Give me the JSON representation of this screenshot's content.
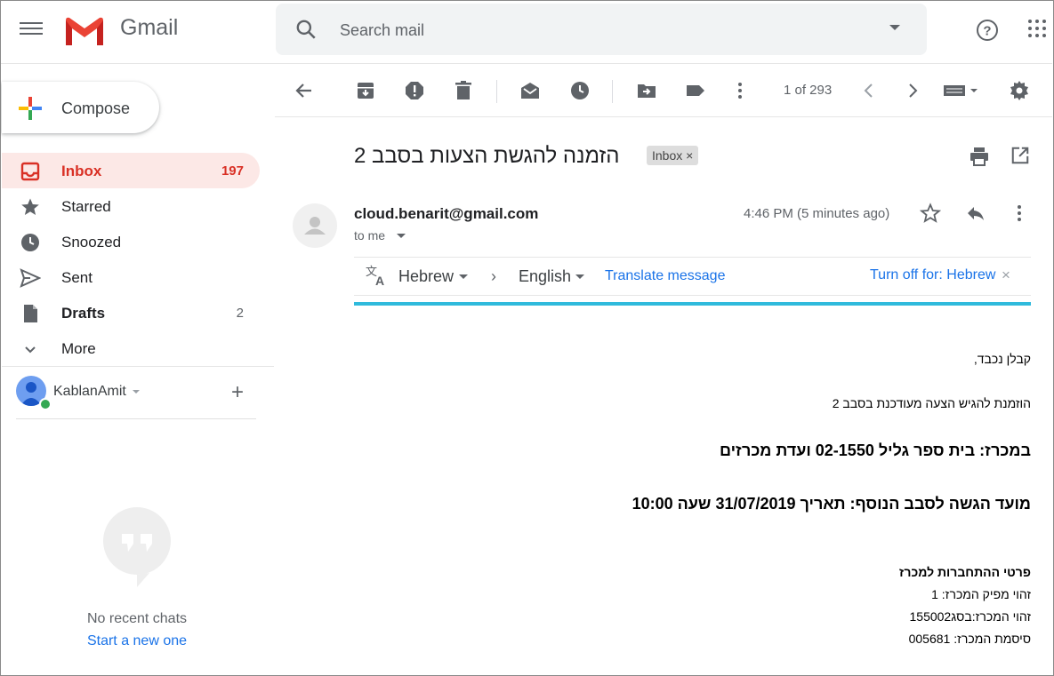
{
  "app": {
    "logo_text": "Gmail"
  },
  "search": {
    "placeholder": "Search mail"
  },
  "compose": {
    "label": "Compose"
  },
  "nav": [
    {
      "label": "Inbox",
      "count": "197",
      "icon": "inbox-icon",
      "active": true
    },
    {
      "label": "Starred",
      "count": "",
      "icon": "star-icon"
    },
    {
      "label": "Snoozed",
      "count": "",
      "icon": "clock-icon"
    },
    {
      "label": "Sent",
      "count": "",
      "icon": "send-icon"
    },
    {
      "label": "Drafts",
      "count": "2",
      "icon": "draft-icon"
    },
    {
      "label": "More",
      "count": "",
      "icon": "chevron-down-icon"
    }
  ],
  "hangouts": {
    "user": "KablanAmit",
    "no_chats": "No recent chats",
    "start_link": "Start a new one"
  },
  "toolbar": {
    "pager": "1 of 293"
  },
  "message": {
    "subject": "הזמנה להגשת הצעות בסבב 2",
    "label_chip": "Inbox",
    "sender": "cloud.benarit@gmail.com",
    "recipient": "to me",
    "time": "4:46 PM (5 minutes ago)"
  },
  "translate": {
    "from_lang": "Hebrew",
    "to_lang": "English",
    "translate_link": "Translate message",
    "turn_off": "Turn off for: Hebrew"
  },
  "body": {
    "greeting": "קבלן נכבד,",
    "intro": "הוזמנת להגיש הצעה מעודכנת בסבב 2",
    "tender_line": "במכרז: בית ספר גליל 02-1550 ועדת מכרזים",
    "deadline_line": "מועד הגשה לסבב הנוסף: תאריך 31/07/2019 שעה 10:00",
    "details_heading": "פרטי ההתחברות למכרז",
    "issuer_id": "זהוי מפיק המכרז: 1",
    "tender_id": "זהוי המכרז:בסג155002",
    "tender_password": "סיסמת המכרז: 005681"
  },
  "colors": {
    "accent_red": "#d93025",
    "link_blue": "#1a73e8",
    "translate_bar": "#2fbadc"
  }
}
